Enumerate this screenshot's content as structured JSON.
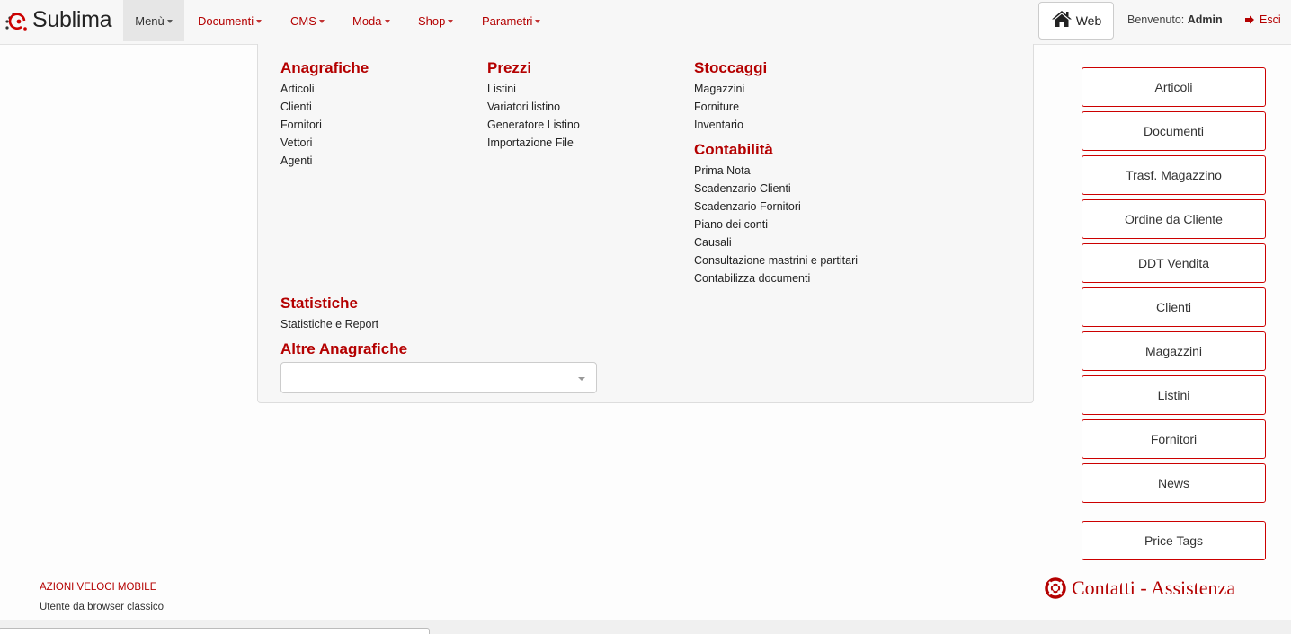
{
  "brand": {
    "name": "Sublima"
  },
  "nav": {
    "items": [
      {
        "label": "Menù"
      },
      {
        "label": "Documenti"
      },
      {
        "label": "CMS"
      },
      {
        "label": "Moda"
      },
      {
        "label": "Shop"
      },
      {
        "label": "Parametri"
      }
    ],
    "web_label": "Web",
    "welcome_prefix": "Benvenuto:",
    "welcome_user": "Admin",
    "logout_label": "Esci"
  },
  "menu": {
    "anagrafiche": {
      "title": "Anagrafiche",
      "items": [
        "Articoli",
        "Clienti",
        "Fornitori",
        "Vettori",
        "Agenti"
      ]
    },
    "prezzi": {
      "title": "Prezzi",
      "items": [
        "Listini",
        "Variatori listino",
        "Generatore Listino",
        "Importazione File"
      ]
    },
    "stoccaggi": {
      "title": "Stoccaggi",
      "items": [
        "Magazzini",
        "Forniture",
        "Inventario"
      ]
    },
    "contabilita": {
      "title": "Contabilità",
      "items": [
        "Prima Nota",
        "Scadenzario Clienti",
        "Scadenzario Fornitori",
        "Piano dei conti",
        "Causali",
        "Consultazione mastrini e partitari",
        "Contabilizza documenti"
      ]
    },
    "statistiche": {
      "title": "Statistiche",
      "items": [
        "Statistiche e Report"
      ]
    },
    "altre": {
      "title": "Altre Anagrafiche",
      "select_value": ""
    }
  },
  "quick_actions": [
    "Articoli",
    "Documenti",
    "Trasf. Magazzino",
    "Ordine da Cliente",
    "DDT Vendita",
    "Clienti",
    "Magazzini",
    "Listini",
    "Fornitori",
    "News"
  ],
  "price_tags_label": "Price Tags",
  "contact_label": "Contatti - Assistenza",
  "footer": {
    "mobile_link": "AZIONI VELOCI MOBILE",
    "browser_note": "Utente da browser classico"
  },
  "colors": {
    "accent": "#b40000",
    "border_accent": "#cc0000"
  }
}
